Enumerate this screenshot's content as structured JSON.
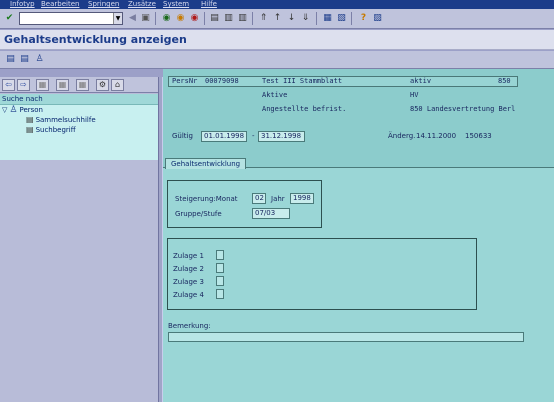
{
  "menubar": {
    "items": [
      "Infotyp",
      "Bearbeiten",
      "Springen",
      "Zusätze",
      "System",
      "Hilfe"
    ]
  },
  "title": "Gehaltsentwicklung anzeigen",
  "nav": {
    "header": "Suche nach",
    "items": [
      {
        "label": "Person",
        "type": "folder"
      },
      {
        "label": "Sammelsuchhilfe",
        "type": "node"
      },
      {
        "label": "Suchbegriff",
        "type": "node"
      }
    ]
  },
  "header": {
    "persnr_label": "PersNr",
    "persnr_value": "00079098",
    "name": "Test III Stammblatt",
    "status": "aktiv",
    "code": "850",
    "employment": "Aktive",
    "employment_code": "HV",
    "contract": "Angestellte befrist.",
    "area": "850 Landesvertretung Berl",
    "valid_label": "Gültig",
    "valid_from": "01.01.1998",
    "valid_sep": "-",
    "valid_to": "31.12.1998",
    "changed_label": "Änderg.",
    "changed_date": "14.11.2000",
    "changed_user": "150633"
  },
  "tab": {
    "label": "Gehaltsentwicklung"
  },
  "raise": {
    "month_label": "Steigerung:Monat",
    "month_value": "02",
    "year_label": "Jahr",
    "year_value": "1998",
    "group_label": "Gruppe/Stufe",
    "group_value": "07/03"
  },
  "allowances": {
    "items": [
      "Zulage 1",
      "Zulage 2",
      "Zulage 3",
      "Zulage 4"
    ]
  },
  "remark": {
    "label": "Bemerkung:",
    "value": ""
  }
}
